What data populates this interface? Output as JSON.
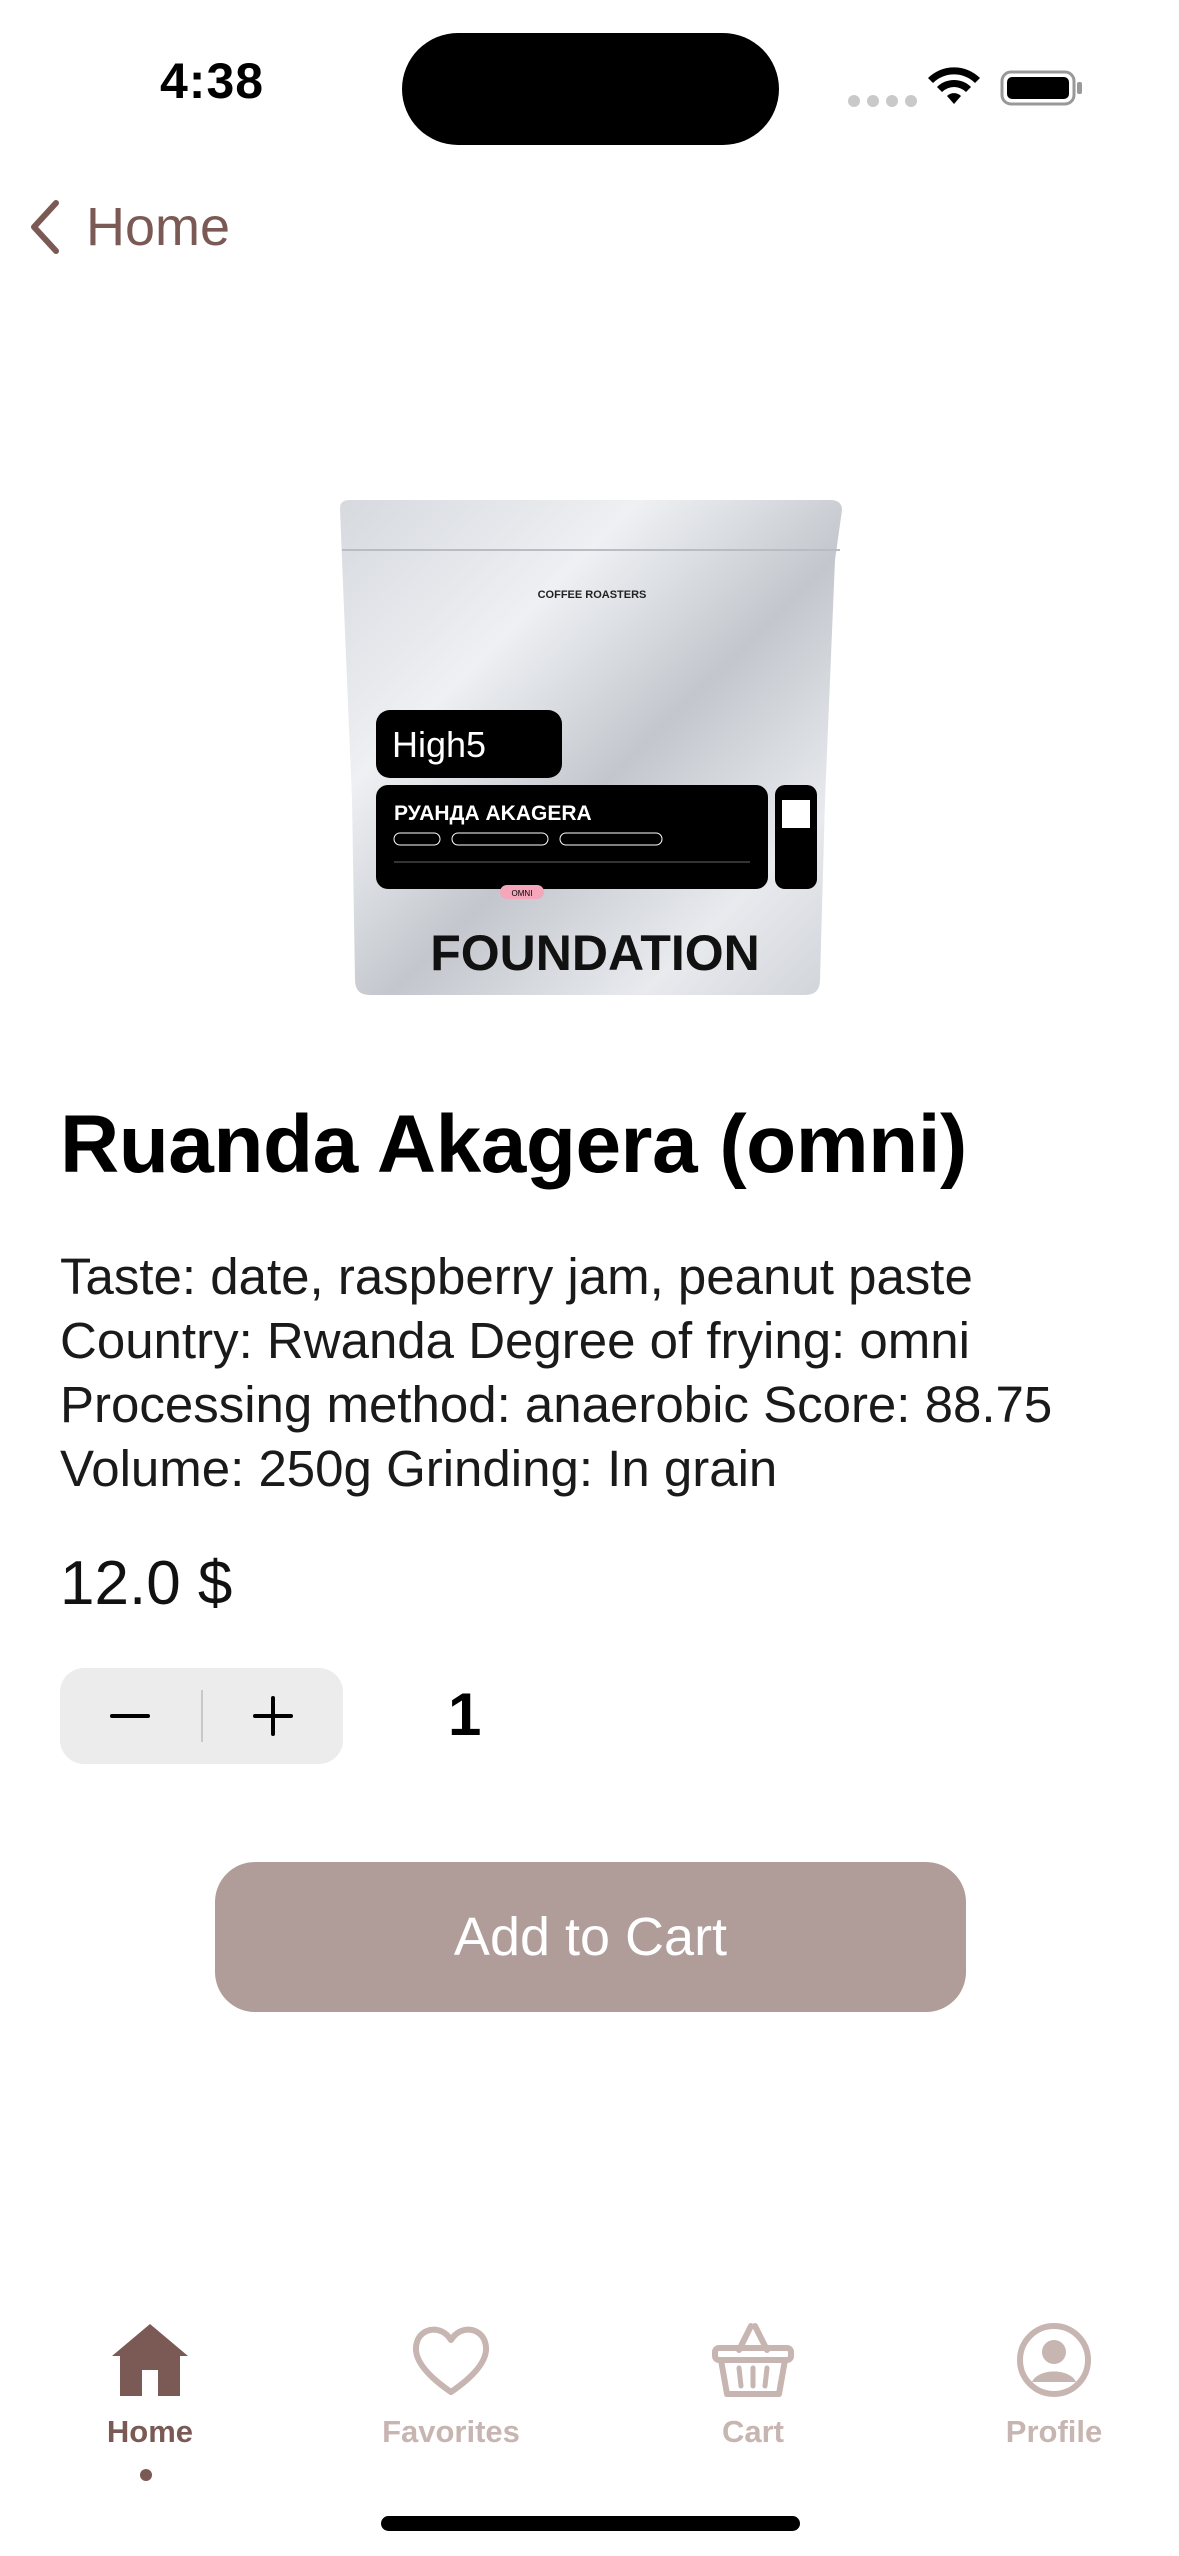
{
  "status_bar": {
    "time": "4:38"
  },
  "nav": {
    "back_label": "Home"
  },
  "product_image": {
    "top_text": "COFFEE ROASTERS",
    "brand": "High5",
    "label_title": "РУАНДА AKAGERA",
    "bottom_text": "FOUNDATION",
    "badge": "OMNI"
  },
  "product": {
    "title": "Ruanda Akagera (omni)",
    "description_lines": [
      "Taste: date, raspberry jam, peanut paste",
      "Country: Rwanda Degree of frying: omni",
      "Processing method: anaerobic Score: 88.75",
      "Volume: 250g Grinding: In grain"
    ],
    "price": "12.0 $",
    "quantity": "1"
  },
  "actions": {
    "add_to_cart": "Add to Cart"
  },
  "tabbar": {
    "tabs": [
      {
        "label": "Home",
        "icon": "house-icon",
        "active": true
      },
      {
        "label": "Favorites",
        "icon": "heart-icon",
        "active": false
      },
      {
        "label": "Cart",
        "icon": "basket-icon",
        "active": false
      },
      {
        "label": "Profile",
        "icon": "person-circle-icon",
        "active": false
      }
    ]
  },
  "colors": {
    "accent": "#7b5a55",
    "inactive": "#c7b5b1",
    "button": "#b09c98",
    "stepper_bg": "#ececec"
  }
}
